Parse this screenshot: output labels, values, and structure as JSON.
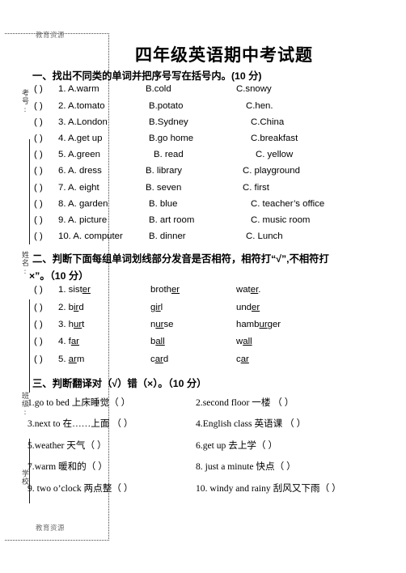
{
  "watermark": {
    "top": "教育资源",
    "bottom": "教育资源"
  },
  "margin_labels": [
    {
      "text": "考号:"
    },
    {
      "text": "姓名:"
    },
    {
      "text": "班级:"
    },
    {
      "text": "学校"
    }
  ],
  "title": "四年级英语期中考试题",
  "sections": [
    {
      "heading": "一、找出不同类的单词并把序号写在括号内。(10 分)",
      "score": "10 分",
      "items": [
        {
          "paren": "(      )",
          "num": "1.",
          "a": "A.warm",
          "b": "B.cold",
          "c": "C.snowy"
        },
        {
          "paren": "(      )",
          "num": "2.",
          "a": "A.tomato",
          "b": "B.potato",
          "c": "C.hen."
        },
        {
          "paren": "(      )",
          "num": "3.",
          "a": "A.London",
          "b": "B.Sydney",
          "c": "C.China"
        },
        {
          "paren": "(      )",
          "num": "4.",
          "a": "A.get up",
          "b": "B.go home",
          "c": "C.breakfast"
        },
        {
          "paren": "(      )",
          "num": "5.",
          "a": "A.green",
          "b": "B. read",
          "c": "C. yellow"
        },
        {
          "paren": "(      )",
          "num": "6.",
          "a": "A. dress",
          "b": "B. library",
          "c": "C. playground"
        },
        {
          "paren": "(      )",
          "num": "7.",
          "a": "A. eight",
          "b": "B. seven",
          "c": "C. first"
        },
        {
          "paren": "(      )",
          "num": "8.",
          "a": "A. garden",
          "b": "B. blue",
          "c": "C. teacher’s office"
        },
        {
          "paren": "(      )",
          "num": "9.",
          "a": "A. picture",
          "b": "B. art   room",
          "c": "C. music   room"
        },
        {
          "paren": "(      )",
          "num": "10.",
          "a": "A. computer",
          "b": "B. dinner",
          "c": "C. Lunch"
        }
      ]
    },
    {
      "heading_line1": "二、判断下面每组单词划线部分发音是否相符，相符打“√”,不相符打",
      "heading_line2": "×”。（10 分）",
      "score": "10 分",
      "items": [
        {
          "paren": "(      )",
          "num": "1.",
          "w1_pre": "sist",
          "w1_u": "er",
          "w1_post": "",
          "w2_pre": "broth",
          "w2_u": "er",
          "w2_post": "",
          "w3_pre": "wat",
          "w3_u": "er",
          "w3_post": "."
        },
        {
          "paren": "(      )",
          "num": "2.",
          "w1_pre": "b",
          "w1_u": "ir",
          "w1_post": "d",
          "w2_pre": "g",
          "w2_u": "ir",
          "w2_post": "l",
          "w3_pre": "und",
          "w3_u": "er",
          "w3_post": ""
        },
        {
          "paren": "(      )",
          "num": "3.",
          "w1_pre": "h",
          "w1_u": "ur",
          "w1_post": "t",
          "w2_pre": "n",
          "w2_u": "ur",
          "w2_post": "se",
          "w3_pre": "hamb",
          "w3_u": "ur",
          "w3_post": "ger"
        },
        {
          "paren": "(      )",
          "num": "4.",
          "w1_pre": "f",
          "w1_u": "ar",
          "w1_post": "",
          "w2_pre": "b",
          "w2_u": "all",
          "w2_post": "",
          "w3_pre": "w",
          "w3_u": "all",
          "w3_post": ""
        },
        {
          "paren": "(      )",
          "num": "5.",
          "w1_pre": "",
          "w1_u": "ar",
          "w1_post": "m",
          "w2_pre": "c",
          "w2_u": "ar",
          "w2_post": "d",
          "w3_pre": "c",
          "w3_u": "ar",
          "w3_post": ""
        }
      ]
    },
    {
      "heading": "三、判断翻译对（√）错（×）。（10 分）",
      "score": "10 分",
      "rows": [
        {
          "left": "1.go to bed 上床睡觉（      ）",
          "right": "2.second floor 一楼 （      ）"
        },
        {
          "left": "3.next to  在……上面 （     ）",
          "right": "4.English class 英语课 （      ）"
        },
        {
          "left": "5.weather  天气（     ）",
          "right": "6.get  up 去上学（     ）"
        },
        {
          "left": "7.warm   暖和的（     ）",
          "right": "8. just  a  minute   快点（     ）"
        },
        {
          "left": "9. two o’clock  两点整（     ）",
          "right": "10. windy and rainy  刮风又下雨（      ）"
        }
      ]
    }
  ]
}
